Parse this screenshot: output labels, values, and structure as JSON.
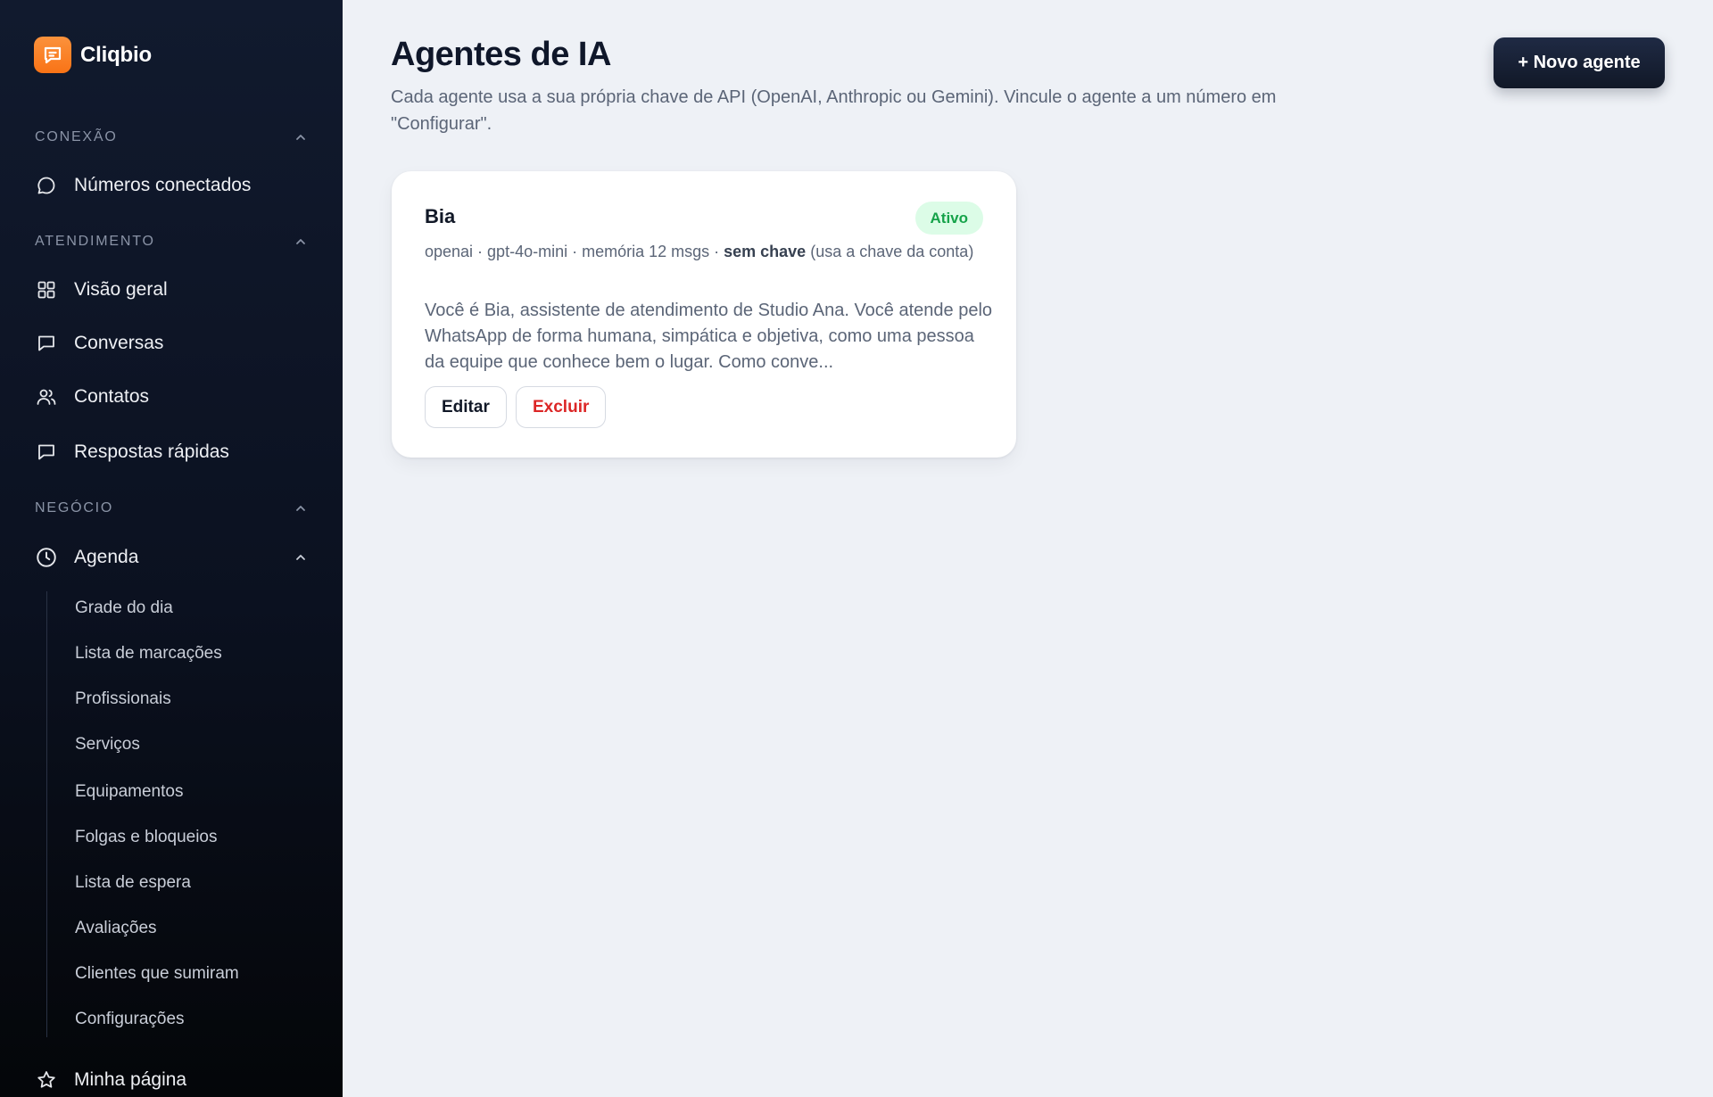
{
  "brand": {
    "name": "Cliqbio",
    "color": "#f97316"
  },
  "sidebar": {
    "sections": [
      {
        "label": "CONEXÃO"
      },
      {
        "label": "ATENDIMENTO"
      },
      {
        "label": "NEGÓCIO"
      }
    ],
    "items": {
      "numeros": "Números conectados",
      "visao_geral": "Visão geral",
      "conversas": "Conversas",
      "contatos": "Contatos",
      "respostas": "Respostas rápidas",
      "agenda": "Agenda",
      "minha_pagina": "Minha página"
    },
    "agenda_subitems": [
      "Grade do dia",
      "Lista de marcações",
      "Profissionais",
      "Serviços",
      "Equipamentos",
      "Folgas e bloqueios",
      "Lista de espera",
      "Avaliações",
      "Clientes que sumiram",
      "Configurações"
    ]
  },
  "main": {
    "title": "Agentes de IA",
    "description": "Cada agente usa a sua própria chave de API (OpenAI, Anthropic ou Gemini). Vincule o agente a um número em \"Configurar\".",
    "new_button": "+ Novo agente"
  },
  "agents": [
    {
      "name": "Bia",
      "status": "Ativo",
      "meta_prefix": "openai · gpt-4o-mini · memória 12 msgs · ",
      "meta_key": "sem chave",
      "meta_suffix": " (usa a chave da conta)",
      "prompt": "Você é Bia, assistente de atendimento de Studio Ana. Você atende pelo WhatsApp de forma humana, simpática e objetiva, como uma pessoa da equipe que conhece bem o lugar. Como conve...",
      "edit_label": "Editar",
      "delete_label": "Excluir"
    }
  ],
  "colors": {
    "sidebar_bg": "#0b1120",
    "page_bg": "#eef1f6",
    "status_active": "#16a34a",
    "danger": "#dc2626"
  }
}
